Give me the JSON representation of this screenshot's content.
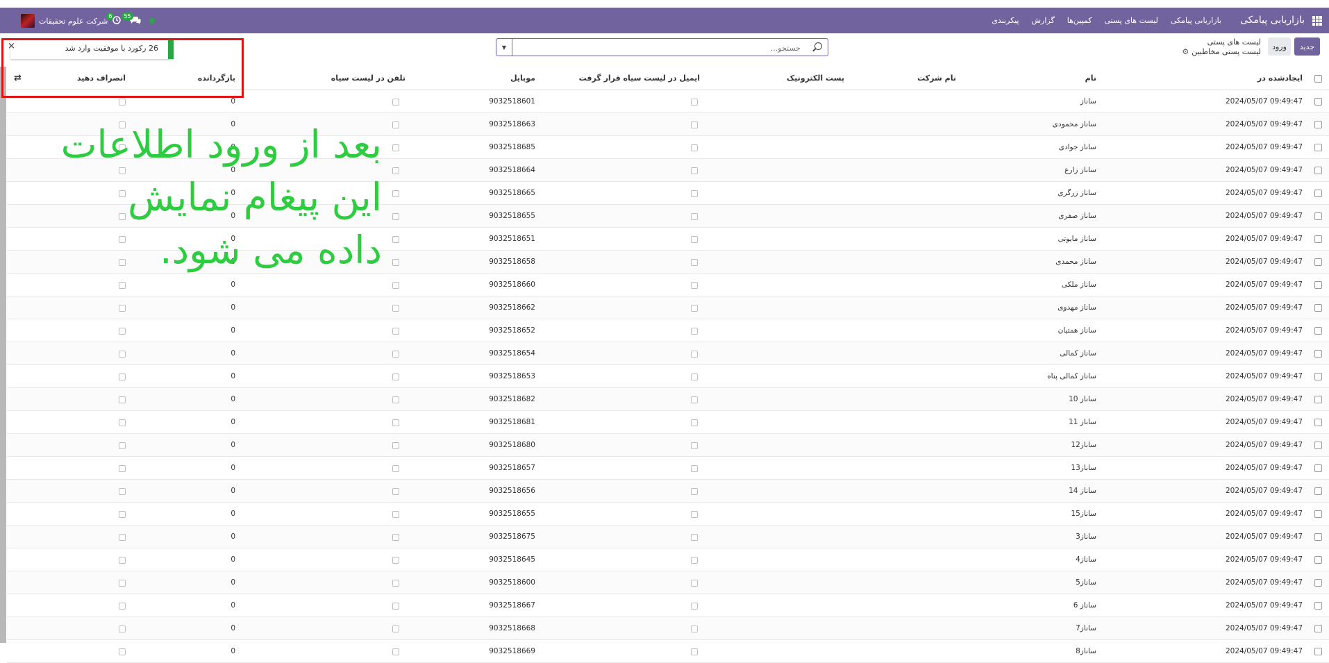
{
  "topbar": {
    "brand": "بازاریابی پیامکی",
    "menu": [
      "بازاریابی پیامکی",
      "لیست های پستی",
      "کمپین‌ها",
      "گزارش",
      "پیکربندی"
    ],
    "company": "شرکت علوم تحقیقات",
    "badge_activity": "6",
    "badge_messages": "55"
  },
  "control": {
    "new_label": "جدید",
    "import_label": "ورود",
    "breadcrumb_parent": "لیست های پستی",
    "breadcrumb_current": "لیست پستی مخاطبین",
    "search_placeholder": "جستجو..."
  },
  "toast": {
    "message": "26 رکورد با موفقیت وارد شد",
    "close": "×"
  },
  "annotation": {
    "line1": "بعد از ورود اطلاعات",
    "line2": "این پیغام نمایش",
    "line3": "داده می شود."
  },
  "table": {
    "columns": [
      "ایجادشده در",
      "نام",
      "نام شرکت",
      "پست الکترونیک",
      "ایمیل در لیست سیاه قرار گرفت",
      "موبایل",
      "تلفن در لیست سیاه",
      "بازگردانده",
      "انصراف دهید"
    ],
    "rows": [
      {
        "created": "2024/05/07 09:49:47",
        "name": "ساناز",
        "mobile": "9032518601",
        "bounce": "0"
      },
      {
        "created": "2024/05/07 09:49:47",
        "name": "ساناز محمودی",
        "mobile": "9032518663",
        "bounce": "0"
      },
      {
        "created": "2024/05/07 09:49:47",
        "name": "ساناز جوادی",
        "mobile": "9032518685",
        "bounce": "0"
      },
      {
        "created": "2024/05/07 09:49:47",
        "name": "ساناز زارع",
        "mobile": "9032518664",
        "bounce": "0"
      },
      {
        "created": "2024/05/07 09:49:47",
        "name": "ساناز زرگری",
        "mobile": "9032518665",
        "bounce": "0"
      },
      {
        "created": "2024/05/07 09:49:47",
        "name": "ساناز صفری",
        "mobile": "9032518655",
        "bounce": "0"
      },
      {
        "created": "2024/05/07 09:49:47",
        "name": "ساناز مایوتی",
        "mobile": "9032518651",
        "bounce": "0"
      },
      {
        "created": "2024/05/07 09:49:47",
        "name": "ساناز محمدی",
        "mobile": "9032518658",
        "bounce": "0"
      },
      {
        "created": "2024/05/07 09:49:47",
        "name": "ساناز ملکی",
        "mobile": "9032518660",
        "bounce": "0"
      },
      {
        "created": "2024/05/07 09:49:47",
        "name": "ساناز مهدوی",
        "mobile": "9032518662",
        "bounce": "0"
      },
      {
        "created": "2024/05/07 09:49:47",
        "name": "ساناز همتیان",
        "mobile": "9032518652",
        "bounce": "0"
      },
      {
        "created": "2024/05/07 09:49:47",
        "name": "ساناز کمالی",
        "mobile": "9032518654",
        "bounce": "0"
      },
      {
        "created": "2024/05/07 09:49:47",
        "name": "ساناز کمالی پناه",
        "mobile": "9032518653",
        "bounce": "0"
      },
      {
        "created": "2024/05/07 09:49:47",
        "name": "ساناز 10",
        "mobile": "9032518682",
        "bounce": "0"
      },
      {
        "created": "2024/05/07 09:49:47",
        "name": "ساناز 11",
        "mobile": "9032518681",
        "bounce": "0"
      },
      {
        "created": "2024/05/07 09:49:47",
        "name": "ساناز12",
        "mobile": "9032518680",
        "bounce": "0"
      },
      {
        "created": "2024/05/07 09:49:47",
        "name": "ساناز13",
        "mobile": "9032518657",
        "bounce": "0"
      },
      {
        "created": "2024/05/07 09:49:47",
        "name": "ساناز 14",
        "mobile": "9032518656",
        "bounce": "0"
      },
      {
        "created": "2024/05/07 09:49:47",
        "name": "ساناز15",
        "mobile": "9032518655",
        "bounce": "0"
      },
      {
        "created": "2024/05/07 09:49:47",
        "name": "ساناز3",
        "mobile": "9032518675",
        "bounce": "0"
      },
      {
        "created": "2024/05/07 09:49:47",
        "name": "ساناز4",
        "mobile": "9032518645",
        "bounce": "0"
      },
      {
        "created": "2024/05/07 09:49:47",
        "name": "ساناز5",
        "mobile": "9032518600",
        "bounce": "0"
      },
      {
        "created": "2024/05/07 09:49:47",
        "name": "ساناز 6",
        "mobile": "9032518667",
        "bounce": "0"
      },
      {
        "created": "2024/05/07 09:49:47",
        "name": "ساناز7",
        "mobile": "9032518668",
        "bounce": "0"
      },
      {
        "created": "2024/05/07 09:49:47",
        "name": "ساناز8",
        "mobile": "9032518669",
        "bounce": "0"
      }
    ]
  }
}
